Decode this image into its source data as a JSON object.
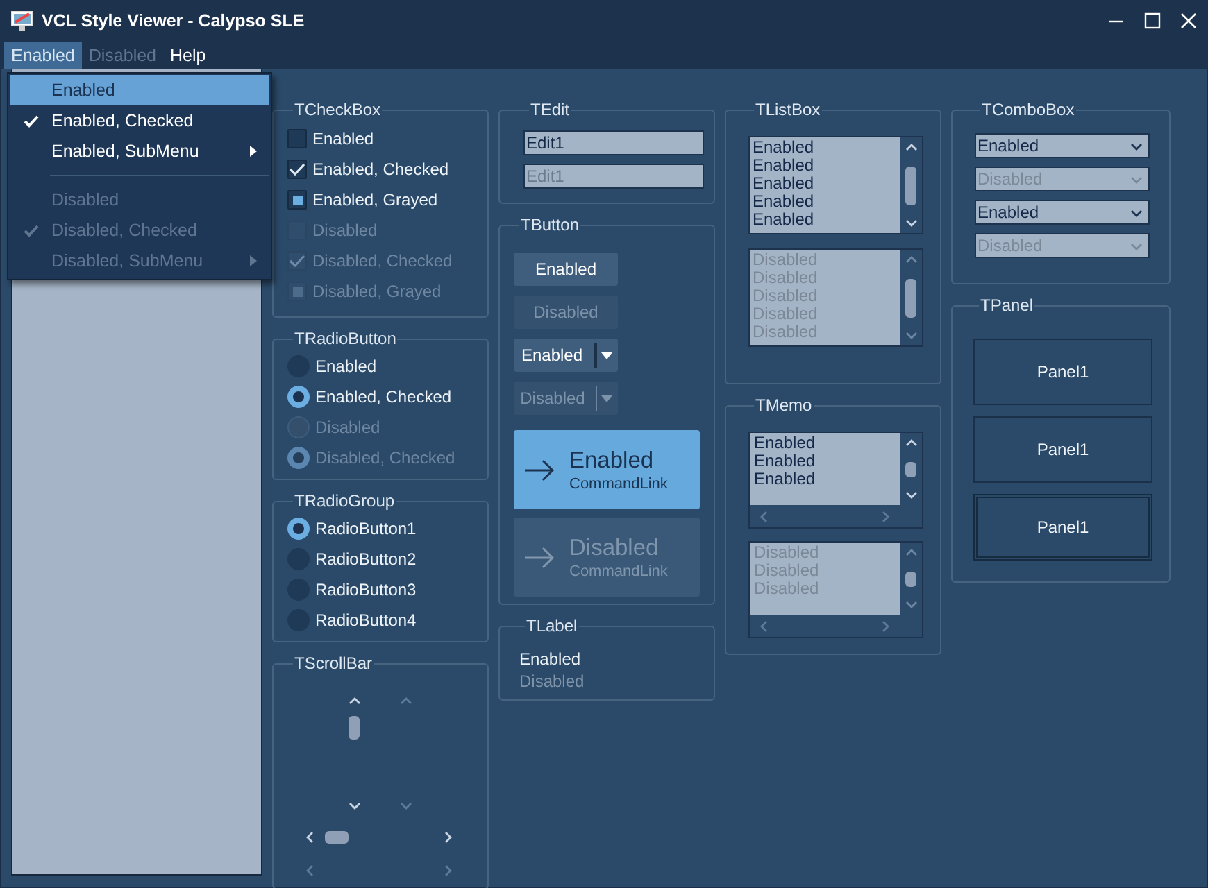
{
  "window": {
    "title": "VCL Style Viewer - Calypso SLE"
  },
  "menubar": [
    {
      "label": "Enabled",
      "selected": true,
      "disabled": false
    },
    {
      "label": "Disabled",
      "selected": false,
      "disabled": true
    },
    {
      "label": "Help",
      "selected": false,
      "disabled": false
    }
  ],
  "dropdown_menu": [
    {
      "kind": "item",
      "label": "Enabled",
      "selected": true,
      "checked": false,
      "disabled": false,
      "submenu": false
    },
    {
      "kind": "item",
      "label": "Enabled, Checked",
      "selected": false,
      "checked": true,
      "disabled": false,
      "submenu": false
    },
    {
      "kind": "item",
      "label": "Enabled, SubMenu",
      "selected": false,
      "checked": false,
      "disabled": false,
      "submenu": true
    },
    {
      "kind": "separator"
    },
    {
      "kind": "item",
      "label": "Disabled",
      "selected": false,
      "checked": false,
      "disabled": true,
      "submenu": false
    },
    {
      "kind": "item",
      "label": "Disabled, Checked",
      "selected": false,
      "checked": true,
      "disabled": true,
      "submenu": false
    },
    {
      "kind": "item",
      "label": "Disabled, SubMenu",
      "selected": false,
      "checked": false,
      "disabled": true,
      "submenu": true
    }
  ],
  "columns": [
    {
      "groups": [
        {
          "kind": "checkbox",
          "title": "TCheckBox",
          "items": [
            {
              "label": "Enabled",
              "checked": false,
              "grayed": false,
              "disabled": false
            },
            {
              "label": "Enabled, Checked",
              "checked": true,
              "grayed": false,
              "disabled": false
            },
            {
              "label": "Enabled, Grayed",
              "checked": false,
              "grayed": true,
              "disabled": false
            },
            {
              "label": "Disabled",
              "checked": false,
              "grayed": false,
              "disabled": true
            },
            {
              "label": "Disabled, Checked",
              "checked": true,
              "grayed": false,
              "disabled": true
            },
            {
              "label": "Disabled, Grayed",
              "checked": false,
              "grayed": true,
              "disabled": true
            }
          ]
        },
        {
          "kind": "radio",
          "title": "TRadioButton",
          "items": [
            {
              "label": "Enabled",
              "selected": false,
              "disabled": false
            },
            {
              "label": "Enabled, Checked",
              "selected": true,
              "disabled": false
            },
            {
              "label": "Disabled",
              "selected": false,
              "disabled": true
            },
            {
              "label": "Disabled, Checked",
              "selected": true,
              "disabled": true
            }
          ]
        },
        {
          "kind": "radio",
          "title": "TRadioGroup",
          "items": [
            {
              "label": "RadioButton1",
              "selected": true,
              "disabled": false
            },
            {
              "label": "RadioButton2",
              "selected": false,
              "disabled": false
            },
            {
              "label": "RadioButton3",
              "selected": false,
              "disabled": false
            },
            {
              "label": "RadioButton4",
              "selected": false,
              "disabled": false
            }
          ]
        },
        {
          "kind": "scrollbar",
          "title": "TScrollBar",
          "items": [
            {
              "kind": "vertical",
              "disabled": false
            },
            {
              "kind": "vertical",
              "disabled": true
            },
            {
              "kind": "horizontal",
              "disabled": false
            },
            {
              "kind": "horizontal",
              "disabled": true
            }
          ]
        }
      ]
    },
    {
      "groups": [
        {
          "kind": "edit",
          "title": "TEdit",
          "items": [
            {
              "value": "Edit1",
              "disabled": false
            },
            {
              "value": "Edit1",
              "disabled": true
            }
          ]
        },
        {
          "kind": "button",
          "title": "TButton",
          "items": [
            {
              "kind": "push",
              "label": "Enabled",
              "disabled": false
            },
            {
              "kind": "push",
              "label": "Disabled",
              "disabled": true
            },
            {
              "kind": "split",
              "label": "Enabled",
              "disabled": false
            },
            {
              "kind": "split",
              "label": "Disabled",
              "disabled": true
            },
            {
              "kind": "command_link",
              "label": "Enabled",
              "note": "CommandLink",
              "disabled": false
            },
            {
              "kind": "command_link",
              "label": "Disabled",
              "note": "CommandLink",
              "disabled": true
            }
          ]
        },
        {
          "kind": "label",
          "title": "TLabel",
          "items": [
            {
              "text": "Enabled",
              "disabled": false
            },
            {
              "text": "Disabled",
              "disabled": true
            }
          ]
        }
      ]
    },
    {
      "groups": [
        {
          "kind": "listbox",
          "title": "TListBox",
          "items": [
            {
              "disabled": false,
              "rows": [
                "Enabled",
                "Enabled",
                "Enabled",
                "Enabled",
                "Enabled"
              ]
            },
            {
              "disabled": true,
              "rows": [
                "Disabled",
                "Disabled",
                "Disabled",
                "Disabled",
                "Disabled"
              ]
            }
          ]
        },
        {
          "kind": "memo",
          "title": "TMemo",
          "items": [
            {
              "disabled": false,
              "lines": [
                "Enabled",
                "Enabled",
                "Enabled"
              ]
            },
            {
              "disabled": true,
              "lines": [
                "Disabled",
                "Disabled",
                "Disabled"
              ]
            }
          ]
        }
      ]
    },
    {
      "groups": [
        {
          "kind": "combo",
          "title": "TComboBox",
          "items": [
            {
              "value": "Enabled",
              "disabled": false
            },
            {
              "value": "Disabled",
              "disabled": true
            },
            {
              "value": "Enabled",
              "disabled": false
            },
            {
              "value": "Disabled",
              "disabled": true
            }
          ]
        },
        {
          "kind": "panel",
          "title": "TPanel",
          "items": [
            {
              "label": "Panel1",
              "kind": "single"
            },
            {
              "label": "Panel1",
              "kind": "single"
            },
            {
              "label": "Panel1",
              "kind": "double"
            }
          ]
        }
      ]
    }
  ]
}
